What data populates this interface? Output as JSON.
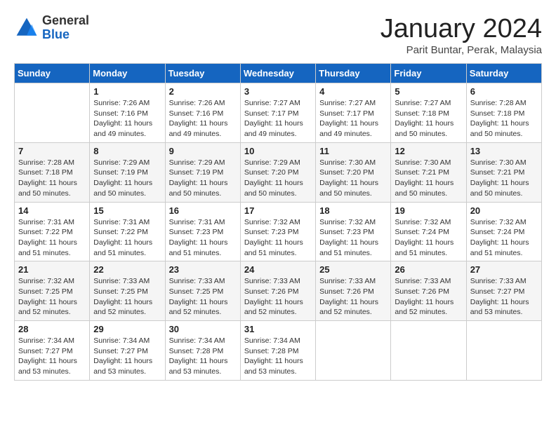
{
  "header": {
    "logo_general": "General",
    "logo_blue": "Blue",
    "month_title": "January 2024",
    "location": "Parit Buntar, Perak, Malaysia"
  },
  "weekdays": [
    "Sunday",
    "Monday",
    "Tuesday",
    "Wednesday",
    "Thursday",
    "Friday",
    "Saturday"
  ],
  "weeks": [
    [
      {
        "day": "",
        "sunrise": "",
        "sunset": "",
        "daylight": ""
      },
      {
        "day": "1",
        "sunrise": "Sunrise: 7:26 AM",
        "sunset": "Sunset: 7:16 PM",
        "daylight": "Daylight: 11 hours and 49 minutes."
      },
      {
        "day": "2",
        "sunrise": "Sunrise: 7:26 AM",
        "sunset": "Sunset: 7:16 PM",
        "daylight": "Daylight: 11 hours and 49 minutes."
      },
      {
        "day": "3",
        "sunrise": "Sunrise: 7:27 AM",
        "sunset": "Sunset: 7:17 PM",
        "daylight": "Daylight: 11 hours and 49 minutes."
      },
      {
        "day": "4",
        "sunrise": "Sunrise: 7:27 AM",
        "sunset": "Sunset: 7:17 PM",
        "daylight": "Daylight: 11 hours and 49 minutes."
      },
      {
        "day": "5",
        "sunrise": "Sunrise: 7:27 AM",
        "sunset": "Sunset: 7:18 PM",
        "daylight": "Daylight: 11 hours and 50 minutes."
      },
      {
        "day": "6",
        "sunrise": "Sunrise: 7:28 AM",
        "sunset": "Sunset: 7:18 PM",
        "daylight": "Daylight: 11 hours and 50 minutes."
      }
    ],
    [
      {
        "day": "7",
        "sunrise": "Sunrise: 7:28 AM",
        "sunset": "Sunset: 7:18 PM",
        "daylight": "Daylight: 11 hours and 50 minutes."
      },
      {
        "day": "8",
        "sunrise": "Sunrise: 7:29 AM",
        "sunset": "Sunset: 7:19 PM",
        "daylight": "Daylight: 11 hours and 50 minutes."
      },
      {
        "day": "9",
        "sunrise": "Sunrise: 7:29 AM",
        "sunset": "Sunset: 7:19 PM",
        "daylight": "Daylight: 11 hours and 50 minutes."
      },
      {
        "day": "10",
        "sunrise": "Sunrise: 7:29 AM",
        "sunset": "Sunset: 7:20 PM",
        "daylight": "Daylight: 11 hours and 50 minutes."
      },
      {
        "day": "11",
        "sunrise": "Sunrise: 7:30 AM",
        "sunset": "Sunset: 7:20 PM",
        "daylight": "Daylight: 11 hours and 50 minutes."
      },
      {
        "day": "12",
        "sunrise": "Sunrise: 7:30 AM",
        "sunset": "Sunset: 7:21 PM",
        "daylight": "Daylight: 11 hours and 50 minutes."
      },
      {
        "day": "13",
        "sunrise": "Sunrise: 7:30 AM",
        "sunset": "Sunset: 7:21 PM",
        "daylight": "Daylight: 11 hours and 50 minutes."
      }
    ],
    [
      {
        "day": "14",
        "sunrise": "Sunrise: 7:31 AM",
        "sunset": "Sunset: 7:22 PM",
        "daylight": "Daylight: 11 hours and 51 minutes."
      },
      {
        "day": "15",
        "sunrise": "Sunrise: 7:31 AM",
        "sunset": "Sunset: 7:22 PM",
        "daylight": "Daylight: 11 hours and 51 minutes."
      },
      {
        "day": "16",
        "sunrise": "Sunrise: 7:31 AM",
        "sunset": "Sunset: 7:23 PM",
        "daylight": "Daylight: 11 hours and 51 minutes."
      },
      {
        "day": "17",
        "sunrise": "Sunrise: 7:32 AM",
        "sunset": "Sunset: 7:23 PM",
        "daylight": "Daylight: 11 hours and 51 minutes."
      },
      {
        "day": "18",
        "sunrise": "Sunrise: 7:32 AM",
        "sunset": "Sunset: 7:23 PM",
        "daylight": "Daylight: 11 hours and 51 minutes."
      },
      {
        "day": "19",
        "sunrise": "Sunrise: 7:32 AM",
        "sunset": "Sunset: 7:24 PM",
        "daylight": "Daylight: 11 hours and 51 minutes."
      },
      {
        "day": "20",
        "sunrise": "Sunrise: 7:32 AM",
        "sunset": "Sunset: 7:24 PM",
        "daylight": "Daylight: 11 hours and 51 minutes."
      }
    ],
    [
      {
        "day": "21",
        "sunrise": "Sunrise: 7:32 AM",
        "sunset": "Sunset: 7:25 PM",
        "daylight": "Daylight: 11 hours and 52 minutes."
      },
      {
        "day": "22",
        "sunrise": "Sunrise: 7:33 AM",
        "sunset": "Sunset: 7:25 PM",
        "daylight": "Daylight: 11 hours and 52 minutes."
      },
      {
        "day": "23",
        "sunrise": "Sunrise: 7:33 AM",
        "sunset": "Sunset: 7:25 PM",
        "daylight": "Daylight: 11 hours and 52 minutes."
      },
      {
        "day": "24",
        "sunrise": "Sunrise: 7:33 AM",
        "sunset": "Sunset: 7:26 PM",
        "daylight": "Daylight: 11 hours and 52 minutes."
      },
      {
        "day": "25",
        "sunrise": "Sunrise: 7:33 AM",
        "sunset": "Sunset: 7:26 PM",
        "daylight": "Daylight: 11 hours and 52 minutes."
      },
      {
        "day": "26",
        "sunrise": "Sunrise: 7:33 AM",
        "sunset": "Sunset: 7:26 PM",
        "daylight": "Daylight: 11 hours and 52 minutes."
      },
      {
        "day": "27",
        "sunrise": "Sunrise: 7:33 AM",
        "sunset": "Sunset: 7:27 PM",
        "daylight": "Daylight: 11 hours and 53 minutes."
      }
    ],
    [
      {
        "day": "28",
        "sunrise": "Sunrise: 7:34 AM",
        "sunset": "Sunset: 7:27 PM",
        "daylight": "Daylight: 11 hours and 53 minutes."
      },
      {
        "day": "29",
        "sunrise": "Sunrise: 7:34 AM",
        "sunset": "Sunset: 7:27 PM",
        "daylight": "Daylight: 11 hours and 53 minutes."
      },
      {
        "day": "30",
        "sunrise": "Sunrise: 7:34 AM",
        "sunset": "Sunset: 7:28 PM",
        "daylight": "Daylight: 11 hours and 53 minutes."
      },
      {
        "day": "31",
        "sunrise": "Sunrise: 7:34 AM",
        "sunset": "Sunset: 7:28 PM",
        "daylight": "Daylight: 11 hours and 53 minutes."
      },
      {
        "day": "",
        "sunrise": "",
        "sunset": "",
        "daylight": ""
      },
      {
        "day": "",
        "sunrise": "",
        "sunset": "",
        "daylight": ""
      },
      {
        "day": "",
        "sunrise": "",
        "sunset": "",
        "daylight": ""
      }
    ]
  ]
}
